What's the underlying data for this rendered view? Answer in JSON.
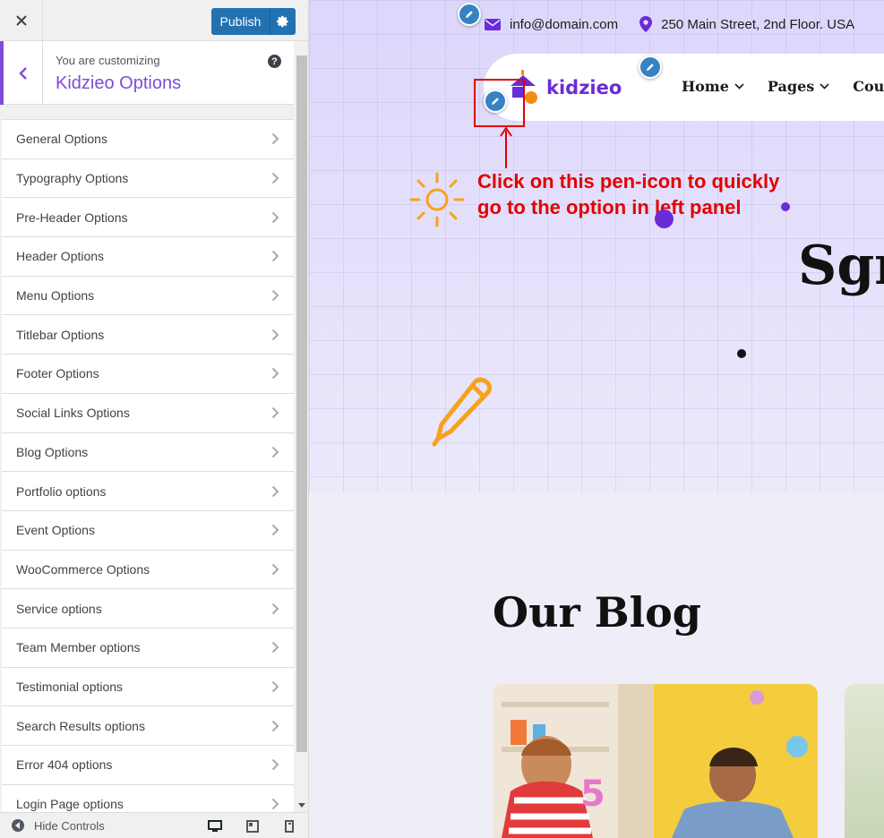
{
  "panel": {
    "publish_label": "Publish",
    "customizing_label": "You are customizing",
    "customizing_title": "Kidzieo Options",
    "help_label": "?",
    "options": [
      {
        "label": "General Options"
      },
      {
        "label": "Typography Options"
      },
      {
        "label": "Pre-Header Options"
      },
      {
        "label": "Header Options"
      },
      {
        "label": "Menu Options"
      },
      {
        "label": "Titlebar Options"
      },
      {
        "label": "Footer Options"
      },
      {
        "label": "Social Links Options"
      },
      {
        "label": "Blog Options"
      },
      {
        "label": "Portfolio options"
      },
      {
        "label": "Event Options"
      },
      {
        "label": "WooCommerce Options"
      },
      {
        "label": "Service options"
      },
      {
        "label": "Team Member options"
      },
      {
        "label": "Testimonial options"
      },
      {
        "label": "Search Results options"
      },
      {
        "label": "Error 404 options"
      },
      {
        "label": "Login Page options"
      }
    ],
    "hide_controls_label": "Hide Controls",
    "devices": [
      "desktop-icon",
      "tablet-icon",
      "mobile-icon"
    ]
  },
  "preview": {
    "email": "info@domain.com",
    "address": "250 Main Street, 2nd Floor. USA",
    "logo_text": "kidzieo",
    "nav": [
      {
        "label": "Home"
      },
      {
        "label": "Pages"
      },
      {
        "label": "Cou"
      }
    ],
    "annotation_line1": "Click on this pen-icon to quickly",
    "annotation_line2": "go to the option in left panel",
    "hero_heading": "Sgr",
    "blog_heading": "Our Blog"
  },
  "colors": {
    "accent": "#7e4dd6",
    "publish": "#2271b1",
    "pen_badge": "#3582c4",
    "annotation": "#e30000",
    "brand": "#6a2bd9"
  }
}
